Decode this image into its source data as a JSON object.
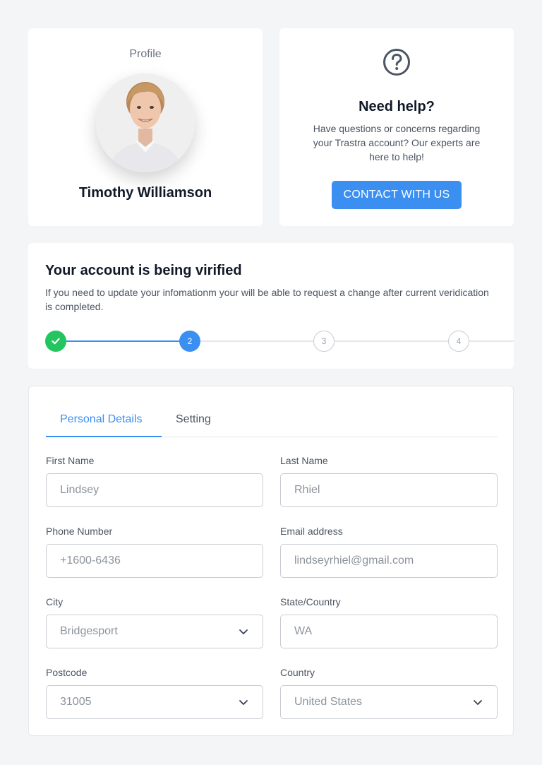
{
  "profile": {
    "label": "Profile",
    "name": "Timothy Williamson"
  },
  "help": {
    "title": "Need help?",
    "text": "Have questions or concerns regarding your Trastra account? Our experts are here to help!",
    "button_label": "CONTACT WITH US",
    "icon": "question-circle-icon"
  },
  "verification": {
    "title": "Your account is being virified",
    "text": "If you need to update your infomationm your will be able to request a change after current veridication is completed.",
    "steps": [
      {
        "label": "",
        "state": "complete",
        "icon": "check-icon"
      },
      {
        "label": "2",
        "state": "active"
      },
      {
        "label": "3",
        "state": "pending"
      },
      {
        "label": "4",
        "state": "pending"
      }
    ]
  },
  "form": {
    "tabs": [
      {
        "label": "Personal Details",
        "active": true
      },
      {
        "label": "Setting",
        "active": false
      }
    ],
    "fields": {
      "first_name": {
        "label": "First Name",
        "value": "Lindsey"
      },
      "last_name": {
        "label": "Last Name",
        "value": "Rhiel"
      },
      "phone": {
        "label": "Phone Number",
        "value": "+1600-6436"
      },
      "email": {
        "label": "Email address",
        "value": "lindseyrhiel@gmail.com"
      },
      "city": {
        "label": "City",
        "value": "Bridgesport"
      },
      "state": {
        "label": "State/Country",
        "value": "WA"
      },
      "postcode": {
        "label": "Postcode",
        "value": "31005"
      },
      "country": {
        "label": "Country",
        "value": "United States"
      }
    }
  },
  "colors": {
    "accent": "#3b8ff0",
    "success": "#22c55e",
    "background": "#f4f5f7"
  }
}
